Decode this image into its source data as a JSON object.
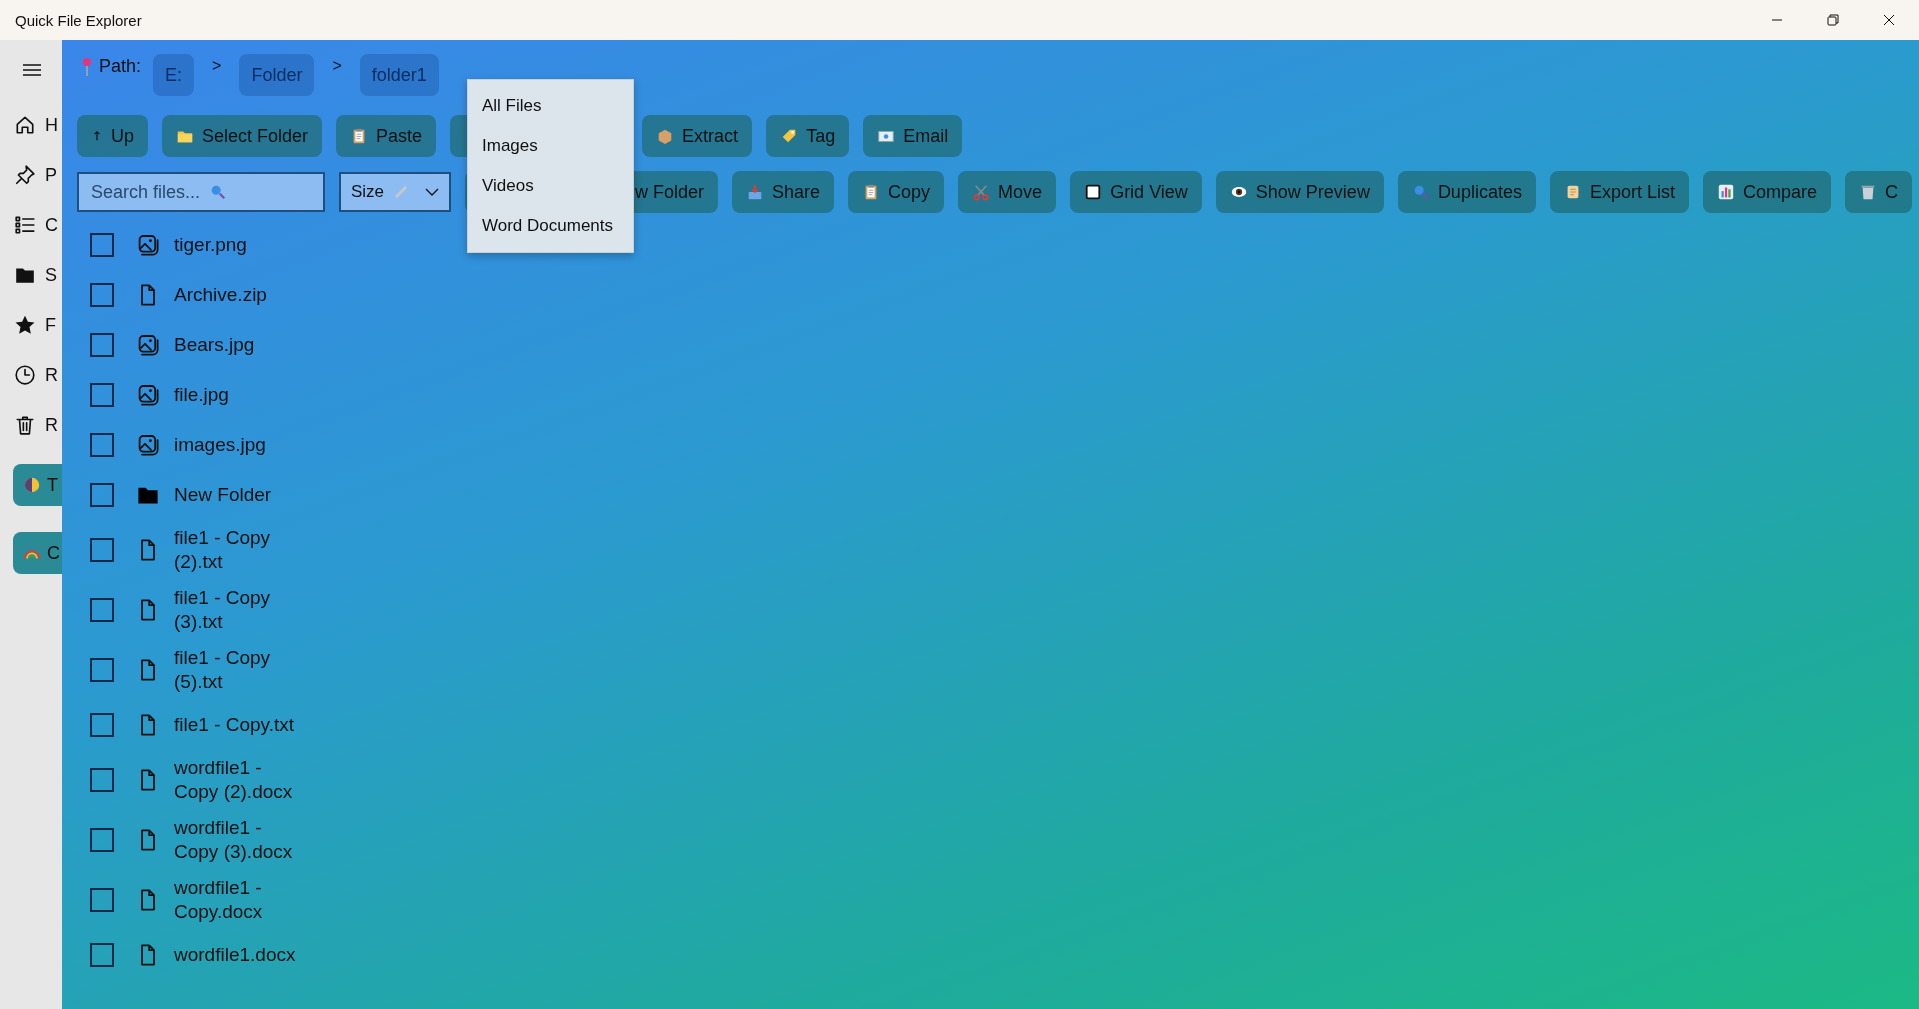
{
  "window": {
    "title": "Quick File Explorer"
  },
  "sidebar": {
    "items": [
      {
        "label": "H"
      },
      {
        "label": "P"
      },
      {
        "label": "C"
      },
      {
        "label": "S"
      },
      {
        "label": "F"
      },
      {
        "label": "R"
      },
      {
        "label": "R"
      }
    ],
    "buttons": [
      {
        "label": "T"
      },
      {
        "label": "C"
      }
    ]
  },
  "path": {
    "label": "Path:",
    "parts": [
      {
        "kind": "chip",
        "text": "E:"
      },
      {
        "kind": "separator",
        "text": ">"
      },
      {
        "kind": "chip",
        "text": "Folder"
      },
      {
        "kind": "separator",
        "text": ">"
      },
      {
        "kind": "chip",
        "text": "folder1"
      }
    ]
  },
  "toolbar_1": [
    {
      "kind": "button",
      "label": "Up"
    },
    {
      "kind": "button",
      "label": "Select Folder"
    },
    {
      "kind": "button",
      "label": "Paste"
    },
    {
      "kind": "covered"
    },
    {
      "kind": "button",
      "label": "Extract"
    },
    {
      "kind": "button",
      "label": "Tag"
    },
    {
      "kind": "button",
      "label": "Email"
    }
  ],
  "search": {
    "placeholder": "Search files..."
  },
  "sort": {
    "value": "Size"
  },
  "toolbar_2": [
    {
      "kind": "partial",
      "label": "w Folder"
    },
    {
      "kind": "button",
      "label": "Share"
    },
    {
      "kind": "button",
      "label": "Copy"
    },
    {
      "kind": "button",
      "label": "Move"
    },
    {
      "kind": "button",
      "label": "Grid View"
    },
    {
      "kind": "button",
      "label": "Show Preview"
    },
    {
      "kind": "button",
      "label": "Duplicates"
    },
    {
      "kind": "button",
      "label": "Export List"
    },
    {
      "kind": "button",
      "label": "Compare"
    },
    {
      "kind": "button",
      "label": "C"
    }
  ],
  "files": [
    {
      "name": "tiger.png",
      "kind": "image",
      "checked": false
    },
    {
      "name": "Archive.zip",
      "kind": "file",
      "checked": false
    },
    {
      "name": "Bears.jpg",
      "kind": "image",
      "checked": false
    },
    {
      "name": "file.jpg",
      "kind": "image",
      "checked": false
    },
    {
      "name": "images.jpg",
      "kind": "image",
      "checked": false
    },
    {
      "name": "New Folder",
      "kind": "folder",
      "checked": false
    },
    {
      "name": "file1 - Copy (2).txt",
      "kind": "file",
      "checked": false
    },
    {
      "name": "file1 - Copy (3).txt",
      "kind": "file",
      "checked": false
    },
    {
      "name": "file1 - Copy (5).txt",
      "kind": "file",
      "checked": false
    },
    {
      "name": "file1 - Copy.txt",
      "kind": "file",
      "checked": false
    },
    {
      "name": "wordfile1 - Copy (2).docx",
      "kind": "file",
      "checked": false
    },
    {
      "name": "wordfile1 - Copy (3).docx",
      "kind": "file",
      "checked": false
    },
    {
      "name": "wordfile1 - Copy.docx",
      "kind": "file",
      "checked": false
    },
    {
      "name": "wordfile1.docx",
      "kind": "file",
      "checked": false
    }
  ],
  "filter_menu": {
    "items": [
      "All Files",
      "Images",
      "Videos",
      "Word Documents"
    ]
  }
}
